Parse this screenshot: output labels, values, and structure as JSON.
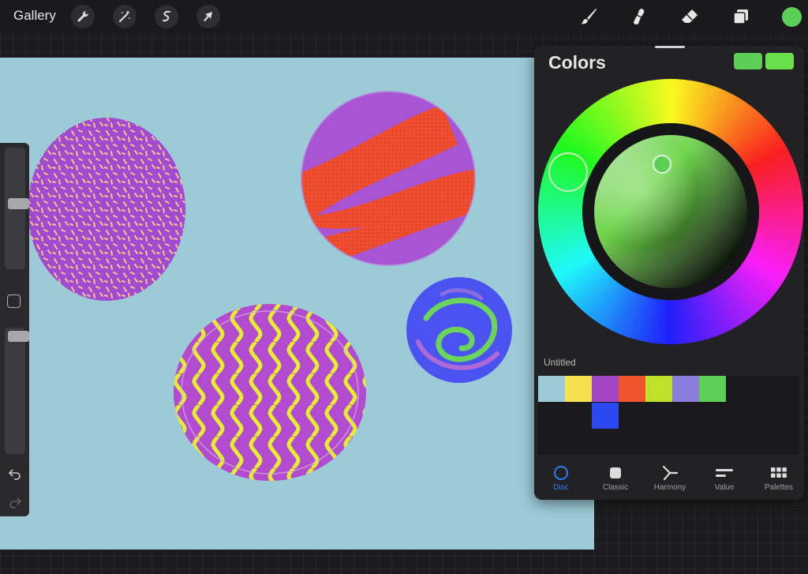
{
  "topbar": {
    "gallery_label": "Gallery",
    "left_tools": [
      "wrench-icon",
      "magic-wand-icon",
      "selection-icon",
      "transform-arrow-icon"
    ],
    "right_tools": [
      "brush-icon",
      "smudge-icon",
      "eraser-icon",
      "layers-icon"
    ],
    "current_color": "#5ccf57"
  },
  "colors_panel": {
    "title": "Colors",
    "primary_color": "#5ccf57",
    "secondary_color": "#6ae04a",
    "palette": {
      "name": "Untitled",
      "swatches": [
        "#9ccbd7",
        "#f5e04e",
        "#a347c7",
        "#f0542d",
        "#bfe12b",
        "#8a7ddb",
        "#5ccf57",
        "#2c48f0"
      ]
    },
    "tabs": [
      {
        "label": "Disc",
        "icon": "disc-icon",
        "active": true
      },
      {
        "label": "Classic",
        "icon": "classic-square-icon",
        "active": false
      },
      {
        "label": "Harmony",
        "icon": "harmony-icon",
        "active": false
      },
      {
        "label": "Value",
        "icon": "value-sliders-icon",
        "active": false
      },
      {
        "label": "Palettes",
        "icon": "palettes-grid-icon",
        "active": false
      }
    ]
  }
}
